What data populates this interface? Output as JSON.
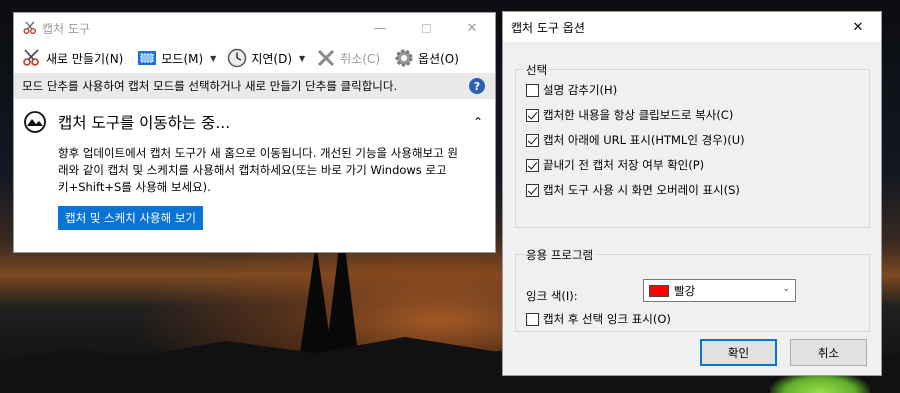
{
  "snipping_tool": {
    "title": "캡처 도구",
    "toolbar": {
      "new": "새로 만들기(N)",
      "mode": "모드(M)",
      "delay": "지연(D)",
      "cancel": "취소(C)",
      "options": "옵션(O)"
    },
    "info": "모드 단추를 사용하여 캡처 모드를 선택하거나 새로 만들기 단추를 클릭합니다.",
    "notice": {
      "title": "캡처 도구를 이동하는 중...",
      "body": "향후 업데이트에서 캡처 도구가 새 홈으로 이동됩니다. 개선된 기능을 사용해보고 원래와 같이 캡처 및 스케치를 사용해서 캡처하세요(또는 바로 가기 Windows 로고 키+Shift+S를 사용해 보세요).",
      "button": "캡처 및 스케치 사용해 보기"
    }
  },
  "options_dialog": {
    "title": "캡처 도구 옵션",
    "selection_group": {
      "label": "선택",
      "items": [
        {
          "label": "설명 감추기(H)",
          "checked": false
        },
        {
          "label": "캡처한 내용을 항상 클립보드로 복사(C)",
          "checked": true
        },
        {
          "label": "캡처 아래에 URL 표시(HTML인 경우)(U)",
          "checked": true
        },
        {
          "label": "끝내기 전 캡처 저장 여부 확인(P)",
          "checked": true
        },
        {
          "label": "캡처 도구 사용 시 화면 오버레이 표시(S)",
          "checked": true
        }
      ]
    },
    "app_group": {
      "label": "응용 프로그램",
      "ink_label": "잉크 색(I):",
      "ink_value": "빨강",
      "ink_color": "#ff0000",
      "show_ink": {
        "label": "캡처 후 선택 잉크 표시(O)",
        "checked": false
      }
    },
    "ok": "확인",
    "cancel": "취소"
  }
}
